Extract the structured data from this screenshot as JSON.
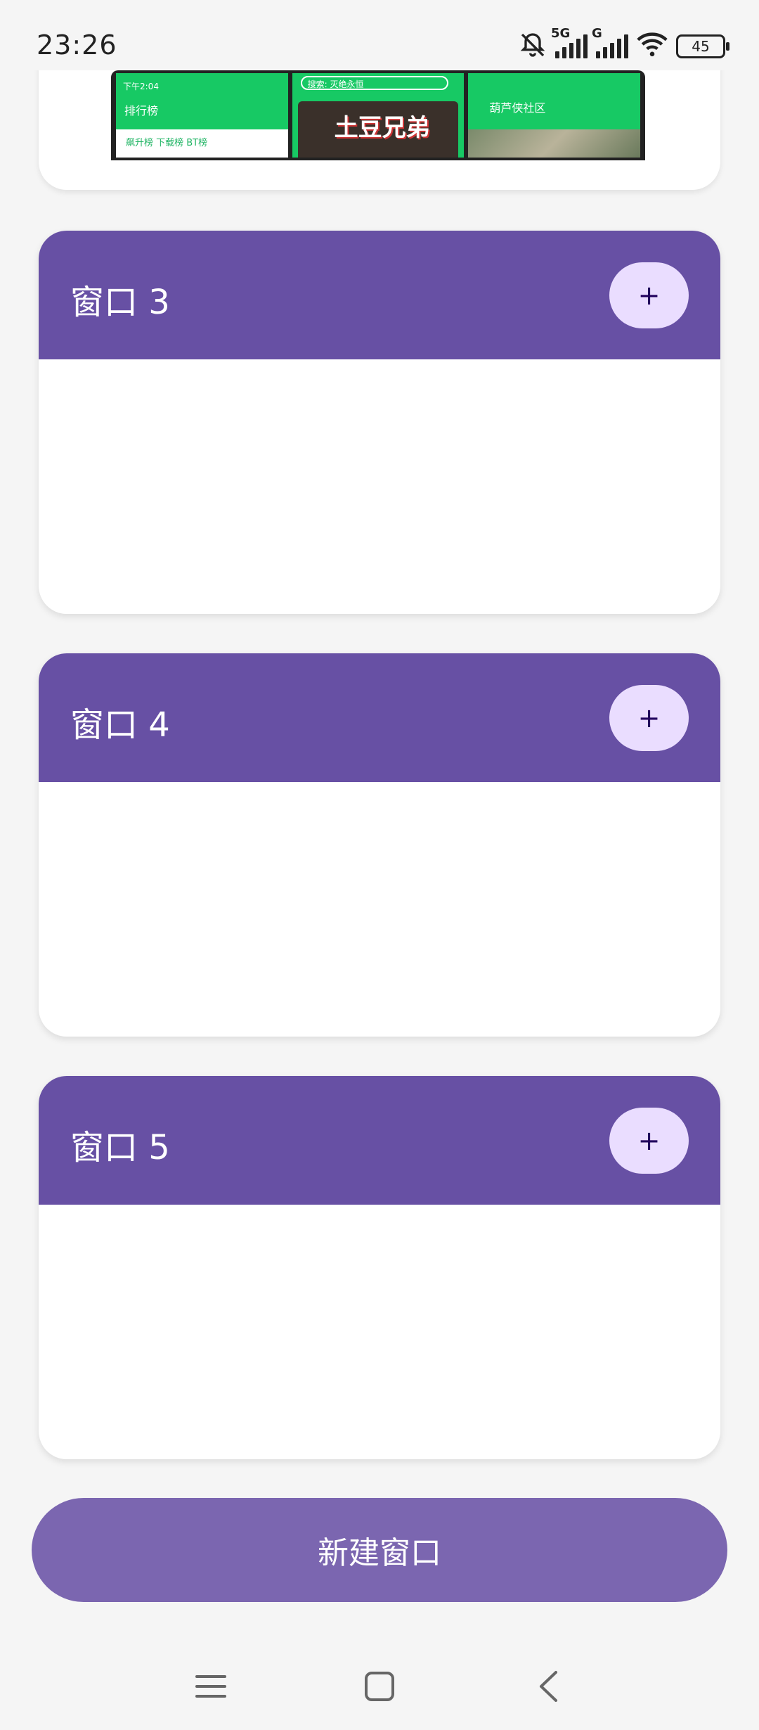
{
  "status": {
    "time": "23:26",
    "network": "5G",
    "network2": "G",
    "battery": "45",
    "icons": [
      "bell-off-icon",
      "signal-5g-icon",
      "signal-g-icon",
      "wifi-icon",
      "battery-icon"
    ]
  },
  "preview": {
    "thumbs": [
      {
        "time": "下午2:04",
        "title": "排行榜",
        "tabs": "飙升榜   下载榜   BT榜"
      },
      {
        "search": "搜索: 灭绝永恒",
        "logo": "土豆兄弟"
      },
      {
        "title": "葫芦侠社区"
      }
    ]
  },
  "windows": [
    {
      "title": "窗口 3",
      "add_label": "+"
    },
    {
      "title": "窗口 4",
      "add_label": "+"
    },
    {
      "title": "窗口 5",
      "add_label": "+"
    }
  ],
  "actions": {
    "new_window": "新建窗口"
  },
  "nav": {
    "icons": [
      "menu-icon",
      "home-icon",
      "back-icon"
    ]
  },
  "colors": {
    "primary": "#6750a4",
    "button": "#7b66b0",
    "add_bg": "#eaddff",
    "background": "#f5f5f5"
  }
}
